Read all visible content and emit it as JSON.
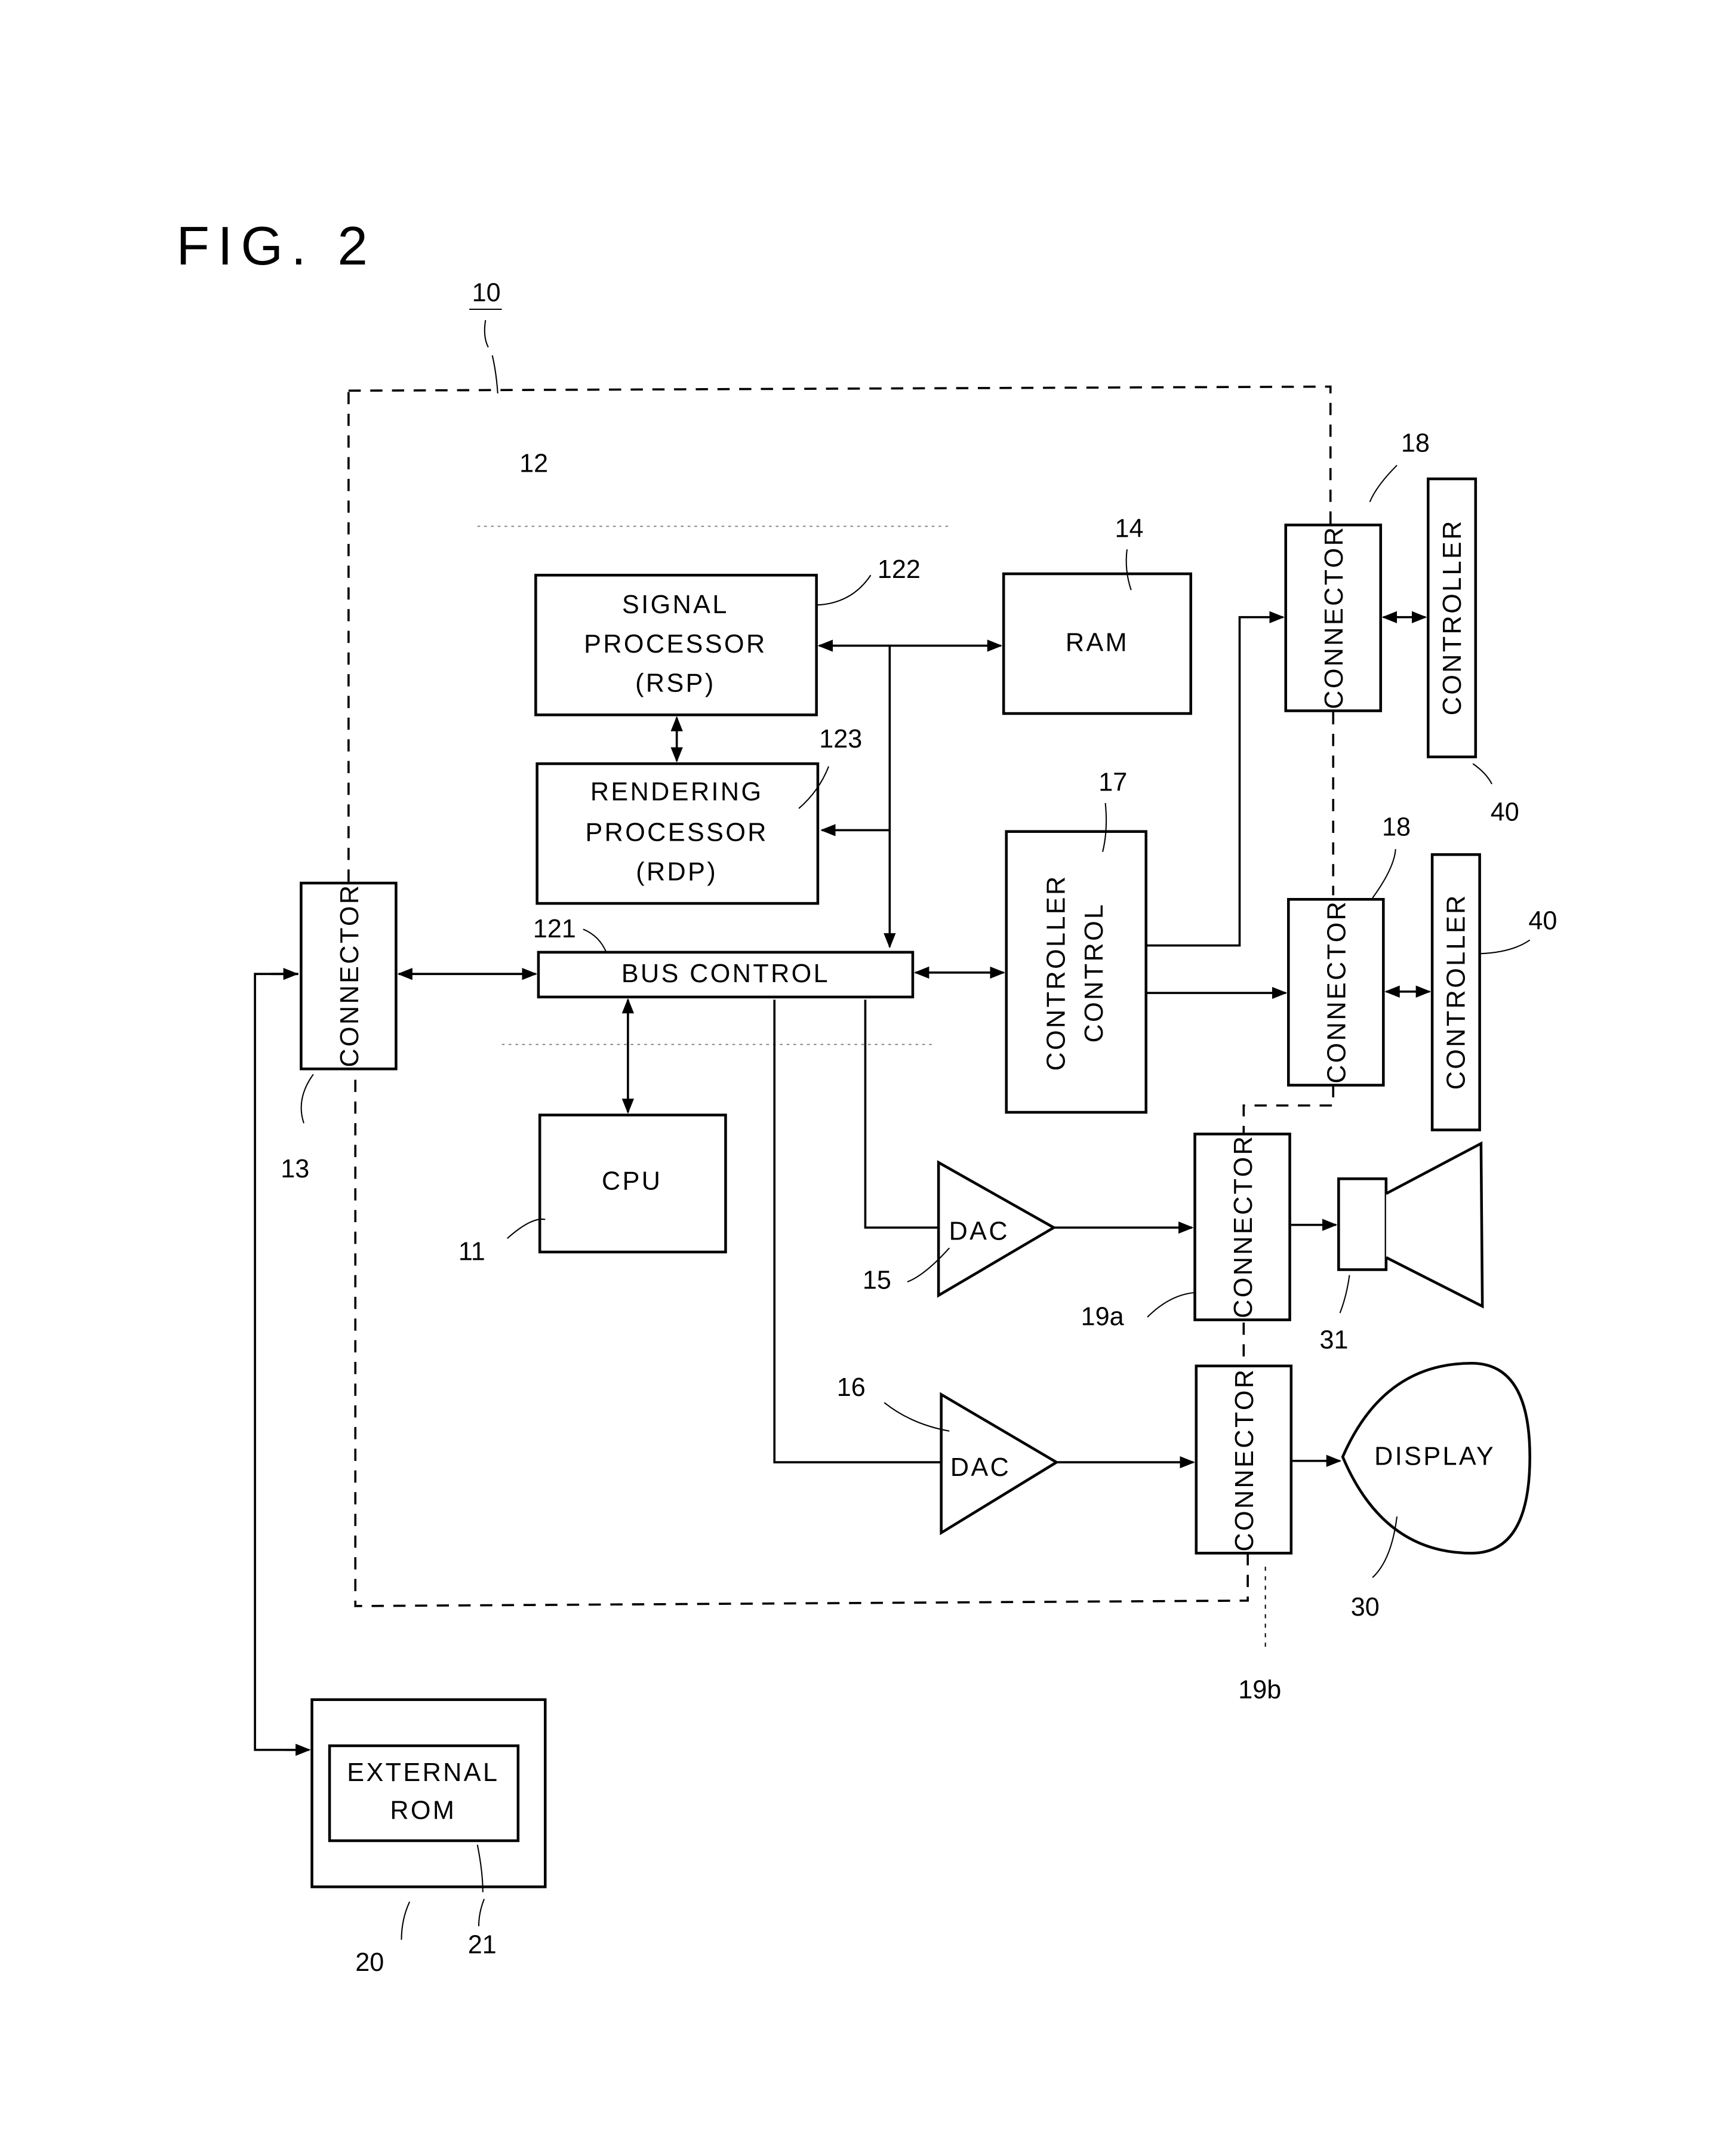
{
  "figure": {
    "title": "FIG. 2",
    "ref_main_unit": "10",
    "ref_processor_area": "12"
  },
  "blocks": {
    "signal_processor": {
      "lines": [
        "SIGNAL",
        "PROCESSOR",
        "(RSP)"
      ],
      "ref": "122"
    },
    "rendering_processor": {
      "lines": [
        "RENDERING",
        "PROCESSOR",
        "(RDP)"
      ],
      "ref": "123"
    },
    "ram": {
      "label": "RAM",
      "ref": "14"
    },
    "bus_control": {
      "label": "BUS CONTROL",
      "ref": "121"
    },
    "cpu": {
      "label": "CPU",
      "ref": "11"
    },
    "connector_13": {
      "label": "CONNECTOR",
      "ref": "13"
    },
    "controller_control": {
      "lines": [
        "CONTROLLER",
        "CONTROL"
      ],
      "ref": "17"
    },
    "connector_18_top": {
      "label": "CONNECTOR",
      "ref": "18"
    },
    "connector_18_bottom": {
      "label": "CONNECTOR",
      "ref": "18"
    },
    "controller_top": {
      "label": "CONTROLLER",
      "ref": "40"
    },
    "controller_bottom": {
      "label": "CONTROLLER",
      "ref": "40"
    },
    "dac_audio": {
      "label": "DAC",
      "ref": "15"
    },
    "dac_video": {
      "label": "DAC",
      "ref": "16"
    },
    "connector_19a": {
      "label": "CONNECTOR",
      "ref": "19a"
    },
    "connector_19b": {
      "label": "CONNECTOR",
      "ref": "19b"
    },
    "speaker": {
      "ref": "31"
    },
    "display": {
      "label": "DISPLAY",
      "ref": "30"
    },
    "cartridge": {
      "ref": "20"
    },
    "external_rom": {
      "lines": [
        "EXTERNAL",
        "ROM"
      ],
      "ref": "21"
    }
  }
}
